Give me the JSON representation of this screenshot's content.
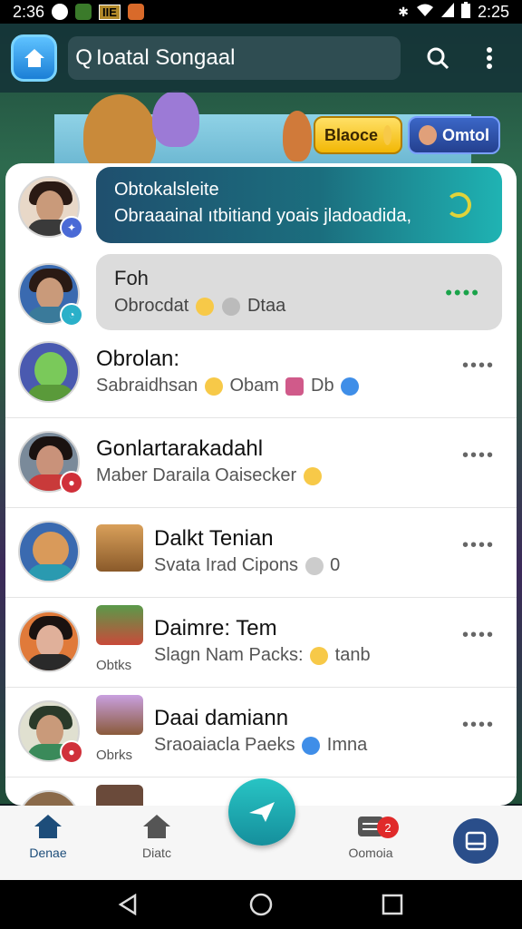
{
  "status_bar": {
    "time_left": "2:36",
    "indicator": "IIE",
    "time_right": "2:25"
  },
  "header": {
    "search_text": "Ioatal Songaal",
    "search_glyph": "Q"
  },
  "top_pills": {
    "left": "Blaoce",
    "right": "Omtol"
  },
  "chats": [
    {
      "title": "Obtokalsleite",
      "message": "Obraaainal ıtbitiand yoais jladoadida,"
    },
    {
      "title": "Foh",
      "message": "Obrocdat",
      "message_end": "Dtaa",
      "more": "••••"
    },
    {
      "name": "Obrolan:",
      "message": "Sabraidhsan",
      "message_mid": "Obam",
      "message_end": "Db"
    },
    {
      "name": "Gonlartarakadahl",
      "message": "Maber Daraila Oaisecker"
    },
    {
      "name": "Dalkt Tenian",
      "message": "Svata Irad Cipons",
      "message_end": "0"
    },
    {
      "name": "Daimre: Tem",
      "tag": "Obtks",
      "message": "Slagn Nam Packs:",
      "message_end": "tanb"
    },
    {
      "name": "Daai damiann",
      "tag": "Obrks",
      "message": "Sraoaiacla Paeks",
      "message_end": "Imna"
    }
  ],
  "row_more": "••••",
  "bottom_nav": {
    "item1": "Denae",
    "item2": "Diatc",
    "item3": "Oomoia",
    "badge": "2"
  },
  "colors": {
    "accent": "#1fb3b3",
    "brand_blue": "#2a4e8a",
    "notification": "#e02a2a"
  }
}
